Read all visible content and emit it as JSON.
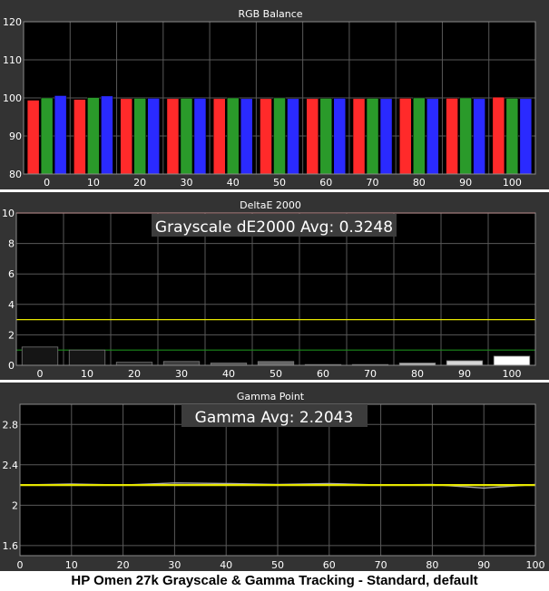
{
  "caption": "HP Omen 27k Grayscale & Gamma Tracking - Standard, default",
  "colors": {
    "panel_bg": "#333333",
    "plot_bg": "#000000",
    "grid": "#595959",
    "text": "#ffffff",
    "red": "#ff2a2a",
    "green": "#2a9a2a",
    "blue": "#2a2aff",
    "threshold_red": "#ff4040",
    "threshold_yellow": "#e6e600",
    "threshold_green": "#1a8a1a",
    "gamma_line": "#e6e600",
    "gamma_line2": "#a8a8a8",
    "label_box": "#3c3c3c"
  },
  "chart_data": [
    {
      "type": "bar",
      "title": "RGB Balance",
      "categories": [
        "0",
        "10",
        "20",
        "30",
        "40",
        "50",
        "60",
        "70",
        "80",
        "90",
        "100"
      ],
      "ylim": [
        80,
        120
      ],
      "yticks": [
        "80",
        "90",
        "100",
        "110",
        "120"
      ],
      "series": [
        {
          "color": "red",
          "values": [
            99.4,
            99.6,
            99.8,
            99.8,
            99.8,
            99.8,
            99.8,
            99.8,
            99.9,
            99.9,
            100.2
          ]
        },
        {
          "color": "green",
          "values": [
            100.0,
            100.1,
            99.9,
            99.9,
            100.0,
            100.0,
            99.9,
            99.9,
            100.0,
            100.0,
            99.9
          ]
        },
        {
          "color": "blue",
          "values": [
            100.6,
            100.5,
            99.9,
            99.9,
            99.8,
            99.8,
            99.9,
            99.8,
            99.8,
            99.8,
            99.8
          ]
        }
      ]
    },
    {
      "type": "bar",
      "title": "DeltaE 2000",
      "annotation": "Grayscale dE2000 Avg: 0.3248",
      "categories": [
        "0",
        "10",
        "20",
        "30",
        "40",
        "50",
        "60",
        "70",
        "80",
        "90",
        "100"
      ],
      "ylim": [
        0,
        10
      ],
      "yticks": [
        "0",
        "2",
        "4",
        "6",
        "8",
        "10"
      ],
      "values": [
        1.2,
        1.0,
        0.2,
        0.25,
        0.15,
        0.25,
        0.05,
        0.05,
        0.15,
        0.3,
        0.6
      ],
      "bar_colors": [
        "#151515",
        "#161616",
        "#2a2a2a",
        "#3c3c3c",
        "#505050",
        "#676767",
        "#7f7f7f",
        "#999999",
        "#b3b3b3",
        "#d6d6d6",
        "#ffffff"
      ],
      "thresholds": [
        {
          "value": 10,
          "color": "red"
        },
        {
          "value": 3,
          "color": "yellow"
        },
        {
          "value": 1,
          "color": "green"
        }
      ]
    },
    {
      "type": "line",
      "title": "Gamma Point",
      "annotation": "Gamma Avg: 2.2043",
      "x": [
        0,
        10,
        20,
        30,
        40,
        50,
        60,
        70,
        80,
        90,
        100
      ],
      "xticks": [
        "0",
        "10",
        "20",
        "30",
        "40",
        "50",
        "60",
        "70",
        "80",
        "90",
        "100"
      ],
      "ylim": [
        1.5,
        3.0
      ],
      "yticks": [
        "1.6",
        "2",
        "2.4",
        "2.8"
      ],
      "series": [
        {
          "role": "target",
          "color": "yellow",
          "values": [
            2.2,
            2.2,
            2.2,
            2.2,
            2.2,
            2.2,
            2.2,
            2.2,
            2.2,
            2.2,
            2.2
          ]
        },
        {
          "role": "measured",
          "color": "gray",
          "values": [
            2.2,
            2.21,
            2.2,
            2.22,
            2.215,
            2.205,
            2.215,
            2.2,
            2.205,
            2.17,
            2.205
          ]
        }
      ]
    }
  ]
}
